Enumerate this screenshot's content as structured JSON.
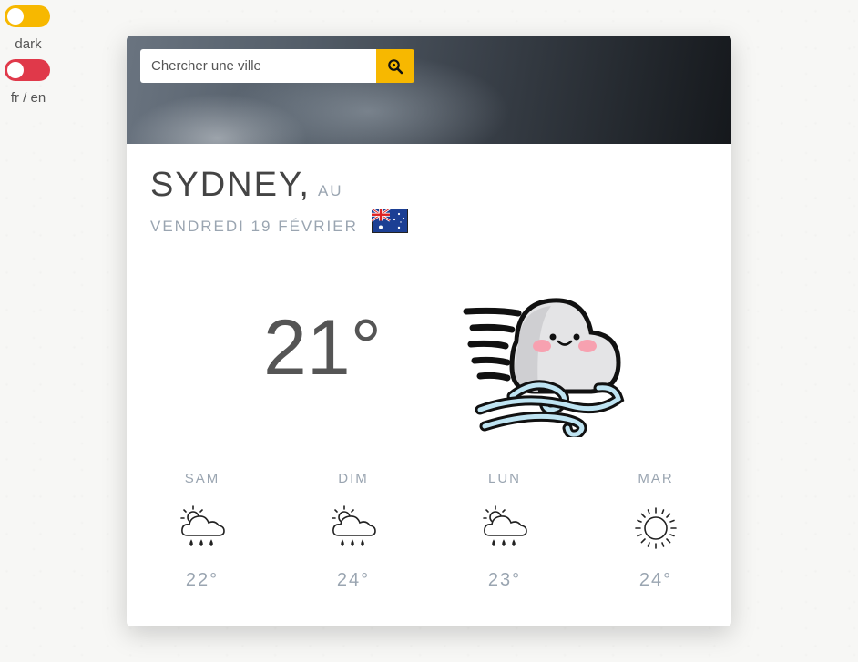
{
  "toggles": {
    "theme_label": "dark",
    "lang_label": "fr / en"
  },
  "search": {
    "placeholder": "Chercher une ville"
  },
  "location": {
    "city": "SYDNEY,",
    "country": "AU",
    "date": "VENDREDI 19 FÉVRIER"
  },
  "current": {
    "temperature": "21°",
    "icon": "windy-cloud-icon"
  },
  "forecast": [
    {
      "day": "SAM",
      "temp": "22°",
      "icon": "partly-sunny-rain-icon"
    },
    {
      "day": "DIM",
      "temp": "24°",
      "icon": "partly-sunny-rain-icon"
    },
    {
      "day": "LUN",
      "temp": "23°",
      "icon": "partly-sunny-rain-icon"
    },
    {
      "day": "MAR",
      "temp": "24°",
      "icon": "sun-icon"
    }
  ],
  "colors": {
    "accent": "#f7b800",
    "lang_toggle": "#e0394a",
    "muted_text": "#9aa5b1"
  }
}
